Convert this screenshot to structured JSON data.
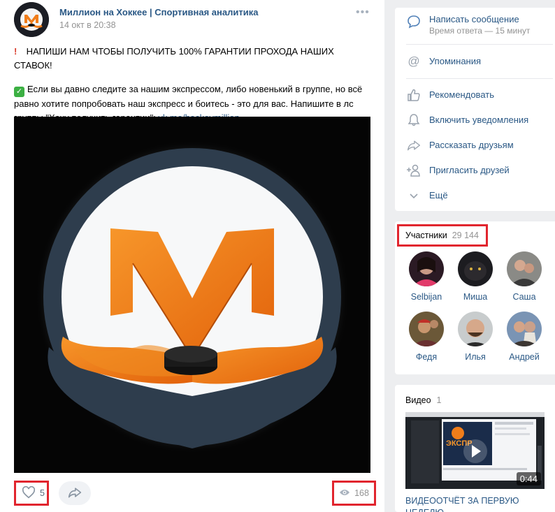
{
  "post": {
    "author": "Миллион на Хоккее | Спортивная аналитика",
    "date": "14 окт в 20:38",
    "more_label": "•••",
    "text_line1": "НАПИШИ НАМ ЧТОБЫ ПОЛУЧИТЬ 100% ГАРАНТИИ ПРОХОДА НАШИХ СТАВОК!",
    "text_line2": "Если вы давно следите за нашим экспрессом, либо новенький в группе, но всё равно хотите попробовать наш экспресс и боитесь - это для вас. Напишите в лс группы \"Хочу получить гарантии\": ",
    "link": "vk.me/hockeymillion",
    "likes": "5",
    "views": "168"
  },
  "actions": {
    "items": [
      {
        "label": "Написать сообщение",
        "sub": "Время ответа — 15 минут",
        "icon": "message-icon"
      },
      {
        "label": "Упоминания",
        "icon": "at-icon"
      },
      {
        "label": "Рекомендовать",
        "icon": "thumbs-up-icon"
      },
      {
        "label": "Включить уведомления",
        "icon": "bell-icon"
      },
      {
        "label": "Рассказать друзьям",
        "icon": "share-icon"
      },
      {
        "label": "Пригласить друзей",
        "icon": "add-user-icon"
      },
      {
        "label": "Ещё",
        "icon": "chevron-down-icon"
      }
    ]
  },
  "members": {
    "title": "Участники",
    "count": "29 144",
    "list": [
      {
        "name": "Selbijan"
      },
      {
        "name": "Миша"
      },
      {
        "name": "Саша"
      },
      {
        "name": "Федя"
      },
      {
        "name": "Илья"
      },
      {
        "name": "Андрей"
      }
    ]
  },
  "video": {
    "title": "Видео",
    "count": "1",
    "duration": "0:44",
    "caption": "ВИДЕООТЧЁТ ЗА ПЕРВУЮ НЕДЕЛЮ"
  },
  "colors": {
    "link": "#2a5885",
    "highlight": "#e1252e",
    "logo_orange": "#f07d1a"
  }
}
